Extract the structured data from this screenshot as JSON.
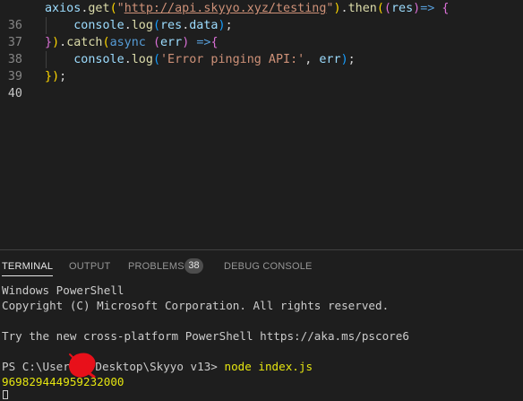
{
  "editor": {
    "lines": [
      {
        "number": "36"
      },
      {
        "number": "37"
      },
      {
        "number": "38"
      },
      {
        "number": "39"
      },
      {
        "number": "40"
      }
    ],
    "code": {
      "l36": {
        "axios": "axios",
        "dot": ".",
        "get": "get",
        "open": "(",
        "url_quote_open": "\"",
        "url": "http://api.skyyo.xyz/testing",
        "url_quote_close": "\"",
        "close": ")",
        "dot2": ".",
        "then": "then",
        "open2": "(",
        "open3": "(",
        "res": "res",
        "close3": ")",
        "arrow": "=>",
        "brace": "{"
      },
      "l37": {
        "console": "console",
        "dot": ".",
        "log": "log",
        "open": "(",
        "res": "res",
        "dot2": ".",
        "data": "data",
        "close": ")",
        "semi": ";"
      },
      "l38": {
        "brace": "}",
        "close": ")",
        "dot": ".",
        "catch": "catch",
        "open": "(",
        "async": "async",
        "open2": "(",
        "err": "err",
        "close2": ")",
        "arrow": "=>",
        "brace2": "{"
      },
      "l39": {
        "console": "console",
        "dot": ".",
        "log": "log",
        "open": "(",
        "str": "'Error pinging API:'",
        "comma": ",",
        "err": "err",
        "close": ")",
        "semi": ";"
      },
      "l40": {
        "brace": "}",
        "close": ")",
        "semi": ";"
      }
    }
  },
  "panel": {
    "tabs": [
      {
        "label": "TERMINAL"
      },
      {
        "label": "OUTPUT"
      },
      {
        "label": "PROBLEMS"
      },
      {
        "label": "DEBUG CONSOLE"
      }
    ],
    "problems_count": "38"
  },
  "terminal": {
    "line1": "Windows PowerShell",
    "line2": "Copyright (C) Microsoft Corporation. All rights reserved.",
    "line3": "Try the new cross-platform PowerShell https://aka.ms/pscore6",
    "prompt_prefix": "PS C:\\Users",
    "prompt_suffix": "Desktop\\Skyyo v13>",
    "command": "node index.js",
    "output": "969829444959232000"
  },
  "colors": {
    "background": "#1e1e1e",
    "redaction": "#e8101a",
    "output_yellow": "#e5e510"
  }
}
